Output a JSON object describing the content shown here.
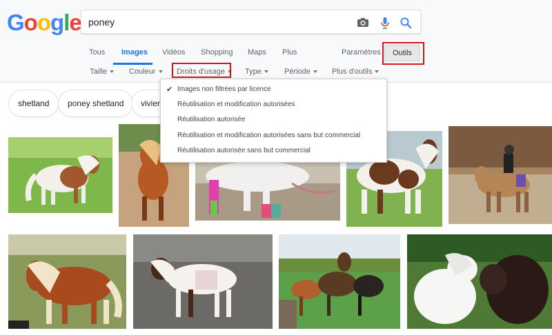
{
  "logo": {
    "letters": [
      "G",
      "o",
      "o",
      "g",
      "l",
      "e"
    ],
    "colors": [
      "#4285f4",
      "#ea4335",
      "#fbbc05",
      "#4285f4",
      "#34a853",
      "#ea4335"
    ]
  },
  "search": {
    "query": "poney"
  },
  "icons": {
    "camera": "camera-icon",
    "mic": "mic-icon",
    "search": "search-icon"
  },
  "tabs": {
    "tous": "Tous",
    "images": "Images",
    "videos": "Vidéos",
    "shopping": "Shopping",
    "maps": "Maps",
    "plus": "Plus",
    "parametres": "Paramètres",
    "outils": "Outils"
  },
  "tools": {
    "taille": "Taille",
    "couleur": "Couleur",
    "droits": "Droits d'usage",
    "type": "Type",
    "periode": "Période",
    "plus_outils": "Plus d'outils"
  },
  "chips": [
    "shetland",
    "poney shetland",
    "viviers"
  ],
  "dropdown": {
    "items": [
      "Images non filtrées par licence",
      "Réutilisation et modification autorisées",
      "Réutilisation autorisée",
      "Réutilisation et modification autorisées sans but commercial",
      "Réutilisation autorisée sans but commercial"
    ],
    "selected_index": 0
  },
  "colors": {
    "accent": "#1a73e8",
    "highlight_box": "#d0161b"
  }
}
